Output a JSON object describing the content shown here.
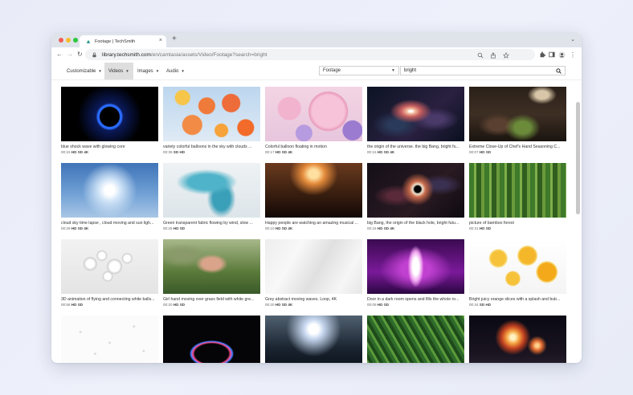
{
  "browser": {
    "tab_title": "Footage | TechSmith",
    "tab_close": "×",
    "new_tab": "+",
    "tab_menu": "⌄",
    "url_host": "library.techsmith.com",
    "url_path": "/en/camtasia/assets/Video/Footage?search=bright",
    "back": "←",
    "forward": "→",
    "reload": "↻",
    "more": "⋮"
  },
  "toolbar": {
    "menus": [
      {
        "label": "Customizable"
      },
      {
        "label": "Videos"
      },
      {
        "label": "Images"
      },
      {
        "label": "Audio"
      }
    ],
    "caret": "▼",
    "category_select": "Footage",
    "select_arrow": "▼",
    "search_value": "bright"
  },
  "results": [
    {
      "title": "blue shock wave with glowing core",
      "duration": "00:15",
      "formats": "HD SD 4K"
    },
    {
      "title": "variety colorful balloons in the sky with clouds ...",
      "duration": "00:35",
      "formats": "SD HD"
    },
    {
      "title": "Colorful balloon floating in motion",
      "duration": "00:17",
      "formats": "HD SD 4K"
    },
    {
      "title": "the origin of the universe. the big Bang, bright fu...",
      "duration": "00:15",
      "formats": "HD SD 4K"
    },
    {
      "title": "Extreme Close-Up of Chef's Hand Seasoning C...",
      "duration": "00:07",
      "formats": "HD SD"
    },
    {
      "title": "cloud sky time lapse , cloud moving and sun ligh...",
      "duration": "00:29",
      "formats": "HD SD 4K"
    },
    {
      "title": "Green transparent fabric flowing by wind, slow ...",
      "duration": "00:25",
      "formats": "HD SD"
    },
    {
      "title": "Happy people are watching an amazing musical ...",
      "duration": "00:10",
      "formats": "HD SD 4K"
    },
    {
      "title": "big Bang, the origin of the black hole, bright futu...",
      "duration": "00:15",
      "formats": "HD SD 4K"
    },
    {
      "title": "picture of bamboo forest",
      "duration": "00:31",
      "formats": "HD SD"
    },
    {
      "title": "3D animation of flying and connecting white balls...",
      "duration": "00:58",
      "formats": "HD SD"
    },
    {
      "title": "Girl hand moving over grass field with white gre...",
      "duration": "00:20",
      "formats": "HD SD"
    },
    {
      "title": "Grey abstract moving waves. Loop, 4K",
      "duration": "00:20",
      "formats": "HD SD 4K"
    },
    {
      "title": "Door in a dark room opens and fills the whole ro...",
      "duration": "00:09",
      "formats": "HD SD"
    },
    {
      "title": "Bright juicy orange slices with a splash and bub...",
      "duration": "00:34",
      "formats": "SD HD"
    },
    {
      "title": "",
      "duration": "",
      "formats": ""
    },
    {
      "title": "",
      "duration": "",
      "formats": ""
    },
    {
      "title": "",
      "duration": "",
      "formats": ""
    },
    {
      "title": "",
      "duration": "",
      "formats": ""
    },
    {
      "title": "",
      "duration": "",
      "formats": ""
    }
  ],
  "colors": {
    "traffic_red": "#f25f57",
    "traffic_yellow": "#f6bd2f",
    "traffic_green": "#2bc840"
  }
}
